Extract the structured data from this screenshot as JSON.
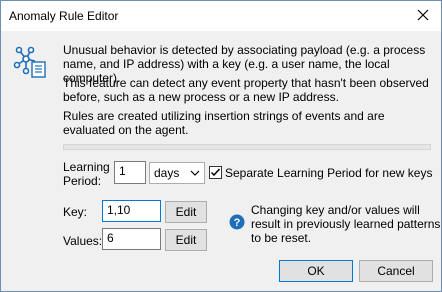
{
  "window": {
    "title": "Anomaly Rule Editor"
  },
  "intro": {
    "para1": "Unusual behavior is detected by associating payload (e.g. a process name, and IP address) with a key (e.g. a user name, the local computer).",
    "para2": "This feature can detect any event property that hasn't been observed before, such as a new process or a new IP address.",
    "para3": "Rules are created utilizing insertion strings of events and are evaluated on the agent."
  },
  "learning": {
    "label_line1": "Learning",
    "label_line2": "Period:",
    "value": "1",
    "unit": "days",
    "separate_label": "Separate Learning Period for new keys",
    "separate_checked": true
  },
  "key": {
    "label": "Key:",
    "value": "1,10",
    "edit_label": "Edit"
  },
  "values": {
    "label": "Values:",
    "value": "6",
    "edit_label": "Edit"
  },
  "note": {
    "line1": "Changing key and/or values will",
    "line2": "result in previously learned patterns",
    "line3": "to be reset."
  },
  "buttons": {
    "ok": "OK",
    "cancel": "Cancel"
  },
  "icons": {
    "app": "network-nodes-icon",
    "close": "close-icon",
    "info": "question-icon",
    "dropdown": "chevron-down-icon"
  },
  "colors": {
    "accent": "#0078d7",
    "app_icon": "#1e6fb8"
  }
}
